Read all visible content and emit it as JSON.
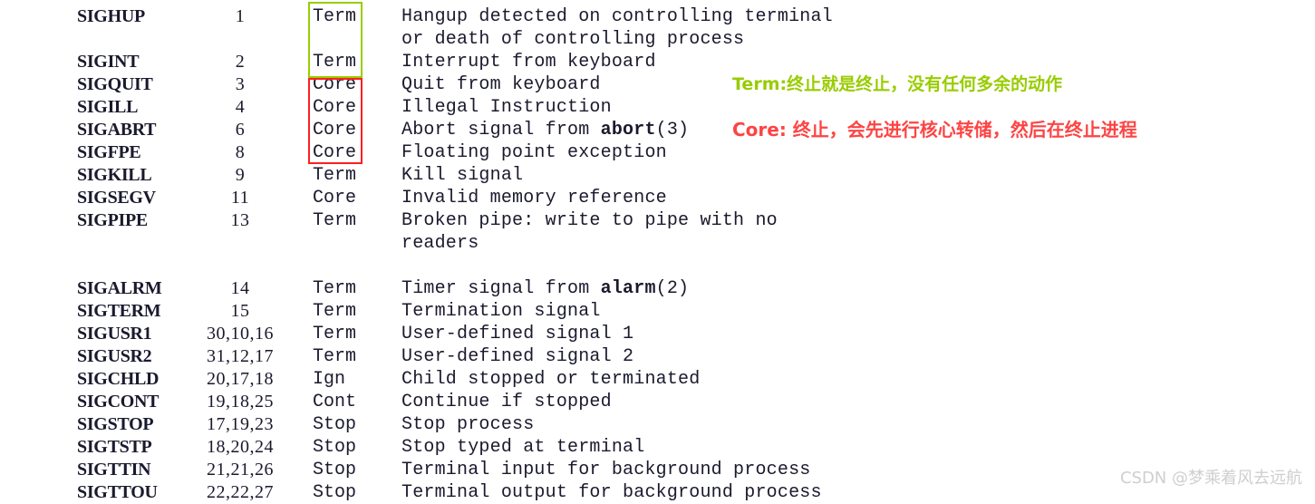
{
  "page": {
    "background": "#ffffff",
    "text_color": "#1a1a2e"
  },
  "colors": {
    "term_green": "#99cc00",
    "core_red": "#fc2020",
    "watermark_gray": "#cfcfcf"
  },
  "table": {
    "rows": [
      {
        "name": "SIGHUP",
        "number": "1",
        "action": "Term",
        "desc_pre": "Hangup detected on controlling terminal",
        "desc_bold": "",
        "desc_post": ""
      },
      {
        "name": "",
        "number": "",
        "action": "",
        "desc_pre": "or death of controlling process",
        "desc_bold": "",
        "desc_post": ""
      },
      {
        "name": "SIGINT",
        "number": "2",
        "action": "Term",
        "desc_pre": "Interrupt from keyboard",
        "desc_bold": "",
        "desc_post": ""
      },
      {
        "name": "SIGQUIT",
        "number": "3",
        "action": "Core",
        "desc_pre": "Quit from keyboard",
        "desc_bold": "",
        "desc_post": ""
      },
      {
        "name": "SIGILL",
        "number": "4",
        "action": "Core",
        "desc_pre": "Illegal Instruction",
        "desc_bold": "",
        "desc_post": ""
      },
      {
        "name": "SIGABRT",
        "number": "6",
        "action": "Core",
        "desc_pre": "Abort signal from ",
        "desc_bold": "abort",
        "desc_post": "(3)"
      },
      {
        "name": "SIGFPE",
        "number": "8",
        "action": "Core",
        "desc_pre": "Floating point exception",
        "desc_bold": "",
        "desc_post": ""
      },
      {
        "name": "SIGKILL",
        "number": "9",
        "action": "Term",
        "desc_pre": "Kill signal",
        "desc_bold": "",
        "desc_post": ""
      },
      {
        "name": "SIGSEGV",
        "number": "11",
        "action": "Core",
        "desc_pre": "Invalid memory reference",
        "desc_bold": "",
        "desc_post": ""
      },
      {
        "name": "SIGPIPE",
        "number": "13",
        "action": "Term",
        "desc_pre": "Broken pipe: write to pipe with no",
        "desc_bold": "",
        "desc_post": ""
      },
      {
        "name": "",
        "number": "",
        "action": "",
        "desc_pre": "readers",
        "desc_bold": "",
        "desc_post": ""
      },
      {
        "name": "",
        "number": "",
        "action": "",
        "desc_pre": "",
        "desc_bold": "",
        "desc_post": ""
      },
      {
        "name": "SIGALRM",
        "number": "14",
        "action": "Term",
        "desc_pre": "Timer signal from ",
        "desc_bold": "alarm",
        "desc_post": "(2)"
      },
      {
        "name": "SIGTERM",
        "number": "15",
        "action": "Term",
        "desc_pre": "Termination signal",
        "desc_bold": "",
        "desc_post": ""
      },
      {
        "name": "SIGUSR1",
        "number": "30,10,16",
        "action": "Term",
        "desc_pre": "User-defined signal 1",
        "desc_bold": "",
        "desc_post": ""
      },
      {
        "name": "SIGUSR2",
        "number": "31,12,17",
        "action": "Term",
        "desc_pre": "User-defined signal 2",
        "desc_bold": "",
        "desc_post": ""
      },
      {
        "name": "SIGCHLD",
        "number": "20,17,18",
        "action": "Ign",
        "desc_pre": "Child stopped or terminated",
        "desc_bold": "",
        "desc_post": ""
      },
      {
        "name": "SIGCONT",
        "number": "19,18,25",
        "action": "Cont",
        "desc_pre": "Continue if stopped",
        "desc_bold": "",
        "desc_post": ""
      },
      {
        "name": "SIGSTOP",
        "number": "17,19,23",
        "action": "Stop",
        "desc_pre": "Stop process",
        "desc_bold": "",
        "desc_post": ""
      },
      {
        "name": "SIGTSTP",
        "number": "18,20,24",
        "action": "Stop",
        "desc_pre": "Stop typed at terminal",
        "desc_bold": "",
        "desc_post": ""
      },
      {
        "name": "SIGTTIN",
        "number": "21,21,26",
        "action": "Stop",
        "desc_pre": "Terminal input for background process",
        "desc_bold": "",
        "desc_post": ""
      },
      {
        "name": "SIGTTOU",
        "number": "22,22,27",
        "action": "Stop",
        "desc_pre": "Terminal output for background process",
        "desc_bold": "",
        "desc_post": ""
      }
    ]
  },
  "annotations": {
    "term_note": "Term:终止就是终止，没有任何多余的动作",
    "core_note": "Core: 终止，会先进行核心转储，然后在终止进程"
  },
  "watermark": {
    "text": "CSDN @梦乘着风去远航"
  }
}
